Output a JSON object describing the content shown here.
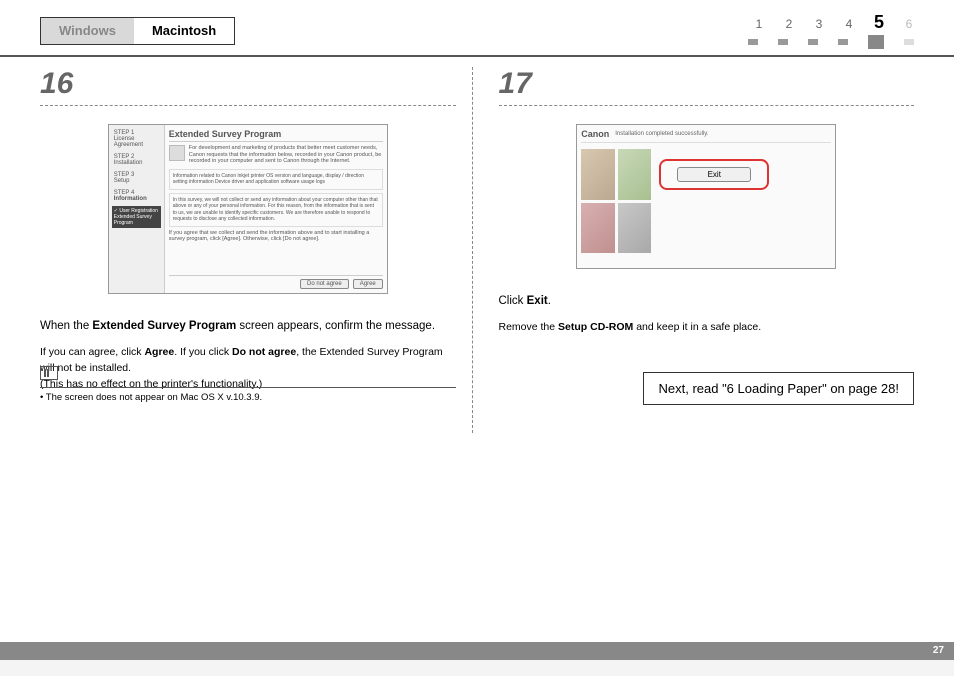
{
  "header": {
    "tab_inactive": "Windows",
    "tab_active": "Macintosh",
    "progress": {
      "n1": "1",
      "n2": "2",
      "n3": "3",
      "n4": "4",
      "n5": "5",
      "n6": "6"
    }
  },
  "step16": {
    "number": "16",
    "dialog": {
      "side_step1": "STEP 1",
      "side_step1_label": "License Agreement",
      "side_step2": "STEP 2",
      "side_step2_label": "Installation",
      "side_step3": "STEP 3",
      "side_step3_label": "Setup",
      "side_step4": "STEP 4",
      "side_step4_label": "Information",
      "side_hl1": "✓ User Registration",
      "side_hl2": "Extended Survey Program",
      "title": "Extended Survey Program",
      "desc": "For development and marketing of products that better meet customer needs, Canon requests that the information below, recorded in your Canon product, be recorded in your computer and sent to Canon through the Internet.",
      "para1": "Information related to Canon inkjet printer\nOS version and language, display / direction setting information\nDevice driver and application software usage logs",
      "para2": "In this survey, we will not collect or send any information about your computer other than that above or any of your personal information. For this reason, from the information that is sent to us, we are unable to identify specific customers.\nWe are therefore unable to respond to requests to disclose any collected information.",
      "para3": "If you agree that we collect and send the information above and to start installing a survey program, click [Agree]. Otherwise, click [Do not agree].",
      "btn_disagree": "Do not agree",
      "btn_agree": "Agree"
    },
    "body_p1_a": "When the ",
    "body_p1_b": "Extended Survey Program",
    "body_p1_c": " screen appears, confirm the message.",
    "body_p2_a": "If you can agree, click ",
    "body_p2_b": "Agree",
    "body_p2_c": ". If you click ",
    "body_p2_d": "Do not agree",
    "body_p2_e": ", the Extended Survey Program will not be installed.",
    "body_p3": "(This has no effect on the printer's functionality.)",
    "note_bullet": "•  The screen does not appear on Mac OS X v.10.3.9."
  },
  "step17": {
    "number": "17",
    "dialog": {
      "logo": "Canon",
      "msg": "Installation completed successfully.",
      "exit": "Exit"
    },
    "body_p1_a": "Click ",
    "body_p1_b": "Exit",
    "body_p1_c": ".",
    "body_p2_a": "Remove the ",
    "body_p2_b": "Setup CD-ROM",
    "body_p2_c": " and keep it in a safe place.",
    "next_read": "Next, read \"6 Loading Paper\" on page 28!"
  },
  "page_number": "27"
}
